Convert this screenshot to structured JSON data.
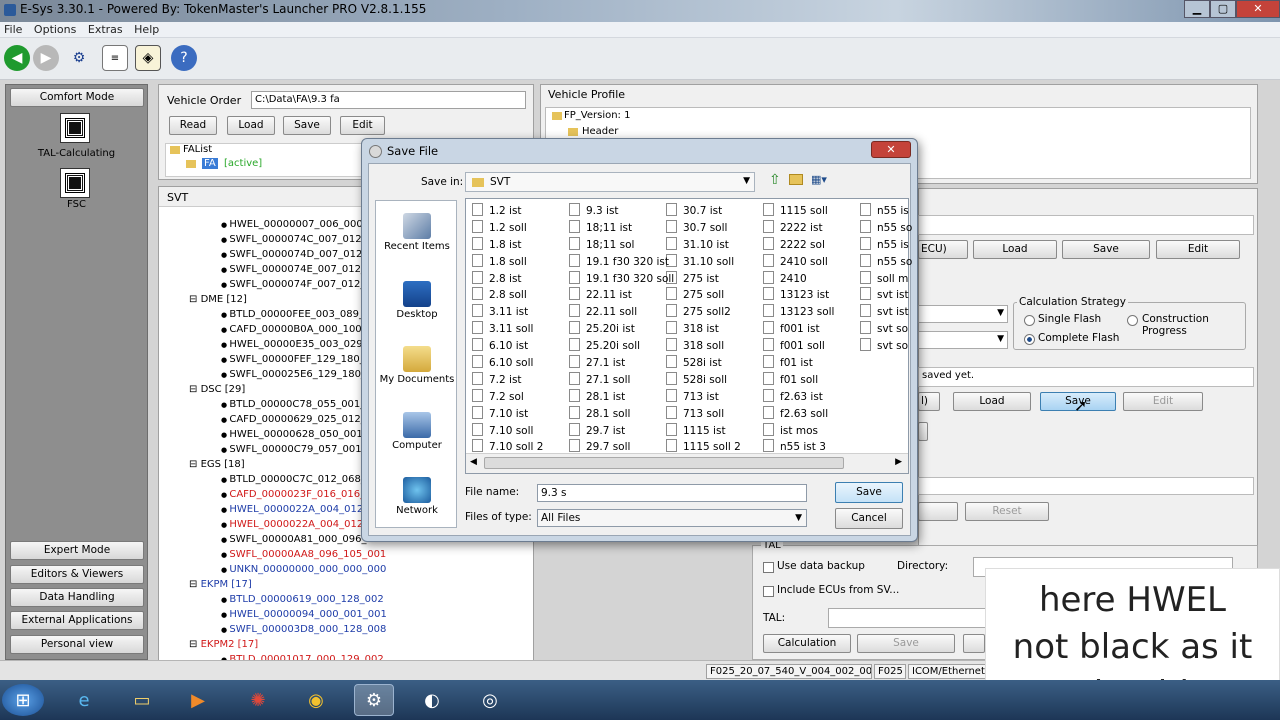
{
  "window": {
    "title": "E-Sys 3.30.1 - Powered By: TokenMaster's Launcher PRO V2.8.1.155"
  },
  "menu": [
    "File",
    "Options",
    "Extras",
    "Help"
  ],
  "left": {
    "comfort": "Comfort Mode",
    "tal_calc": "TAL-Calculating",
    "fsc": "FSC",
    "expert": "Expert Mode",
    "editors": "Editors & Viewers",
    "data": "Data Handling",
    "external": "External Applications",
    "personal": "Personal view"
  },
  "order": {
    "label": "Vehicle Order",
    "path": "C:\\Data\\FA\\9.3 fa",
    "read": "Read",
    "load": "Load",
    "save": "Save",
    "edit": "Edit",
    "falist": "FAList",
    "fa": "FA",
    "active": "[active]"
  },
  "svt": {
    "label": "SVT"
  },
  "tree": [
    {
      "t": "HWEL_00000007_006_000_",
      "c": "k"
    },
    {
      "t": "SWFL_0000074C_007_012_",
      "c": "k"
    },
    {
      "t": "SWFL_0000074D_007_012_",
      "c": "k"
    },
    {
      "t": "SWFL_0000074E_007_012_",
      "c": "k"
    },
    {
      "t": "SWFL_0000074F_007_012_",
      "c": "k"
    },
    {
      "t": "DME [12]",
      "c": "g"
    },
    {
      "t": "BTLD_00000FEE_003_089_",
      "c": "k"
    },
    {
      "t": "CAFD_00000B0A_000_100_",
      "c": "k"
    },
    {
      "t": "HWEL_00000E35_003_029_",
      "c": "k"
    },
    {
      "t": "SWFL_00000FEF_129_180_",
      "c": "k"
    },
    {
      "t": "SWFL_000025E6_129_180_",
      "c": "k"
    },
    {
      "t": "DSC [29]",
      "c": "g"
    },
    {
      "t": "BTLD_00000C78_055_001_",
      "c": "k"
    },
    {
      "t": "CAFD_00000629_025_012_",
      "c": "k"
    },
    {
      "t": "HWEL_00000628_050_001_",
      "c": "k"
    },
    {
      "t": "SWFL_00000C79_057_001_",
      "c": "k"
    },
    {
      "t": "EGS [18]",
      "c": "g"
    },
    {
      "t": "BTLD_00000C7C_012_068_",
      "c": "k"
    },
    {
      "t": "CAFD_0000023F_016_016_",
      "c": "r"
    },
    {
      "t": "HWEL_0000022A_004_012_",
      "c": "b"
    },
    {
      "t": "HWEL_0000022A_004_012_",
      "c": "r"
    },
    {
      "t": "SWFL_00000A81_000_096_",
      "c": "k"
    },
    {
      "t": "SWFL_00000AA8_096_105_001",
      "c": "r"
    },
    {
      "t": "UNKN_00000000_000_000_000",
      "c": "b"
    },
    {
      "t": "EKPM [17]",
      "c": "gb"
    },
    {
      "t": "BTLD_00000619_000_128_002",
      "c": "b"
    },
    {
      "t": "HWEL_00000094_000_001_001",
      "c": "b"
    },
    {
      "t": "SWFL_000003D8_000_128_008",
      "c": "b"
    },
    {
      "t": "EKPM2 [17]",
      "c": "gr"
    },
    {
      "t": "BTLD_00001017_000_129_002",
      "c": "r"
    }
  ],
  "profile": {
    "label": "Vehicle Profile",
    "fp": "FP_Version: 1",
    "header": "Header"
  },
  "right": {
    "ecu_tail": "ECU)",
    "load1": "Load",
    "save1": "Save",
    "edit1": "Edit",
    "calc_strategy": "Calculation Strategy",
    "single": "Single Flash",
    "construction": "Construction Progress",
    "complete": "Complete Flash",
    "saved": "saved yet.",
    "tail2": "l)",
    "load2": "Load",
    "save2": "Save",
    "edit2": "Edit",
    "reset": "Reset",
    "tal_hdr": "TAL",
    "use_backup": "Use data backup",
    "directory": "Directory:",
    "include_ecus": "Include ECUs from SV...",
    "tal_label": "TAL:",
    "calculation": "Calculation",
    "save3": "Save"
  },
  "dialog": {
    "title": "Save File",
    "save_in": "Save in:",
    "folder": "SVT",
    "places": [
      "Recent Items",
      "Desktop",
      "My Documents",
      "Computer",
      "Network"
    ],
    "files": [
      [
        "1.2 ist",
        "1.2 soll",
        "1.8 ist",
        "1.8 soll",
        "2.8 ist",
        "2.8 soll",
        "3.11 ist",
        "3.11 soll",
        "6.10 ist",
        "6.10 soll",
        "7.2 ist",
        "7.2 sol",
        "7.10 ist",
        "7.10 soll",
        "7.10 soll 2"
      ],
      [
        "9.3 ist",
        "18;11 ist",
        "18;11 sol",
        "19.1 f30 320 ist",
        "19.1 f30 320 soll",
        "22.11 ist",
        "22.11 soll",
        "25.20i ist",
        "25.20i soll",
        "27.1 ist",
        "27.1 soll",
        "28.1 ist",
        "28.1 soll",
        "29.7 ist",
        "29.7 soll"
      ],
      [
        "30.7 ist",
        "30.7 soll",
        "31.10 ist",
        "31.10 soll",
        "275 ist",
        "275 soll",
        "275 soll2",
        "318 ist",
        "318 soll",
        "528i ist",
        "528i soll",
        "713 ist",
        "713 soll",
        "1115 ist",
        "1115 soll 2"
      ],
      [
        "1115 soll",
        "2222 ist",
        "2222 sol",
        "2410 soll",
        "2410",
        "13123 ist",
        "13123 soll",
        "f001 ist",
        "f001 soll",
        "f01 ist",
        "f01 soll",
        "f2.63 ist",
        "f2.63 soll",
        "ist mos",
        "n55 ist 3"
      ],
      [
        "n55 is",
        "n55 so",
        "n55 is",
        "n55 so",
        "soll m",
        "svt ist",
        "svt ist",
        "svt so",
        "svt so"
      ]
    ],
    "file_name_label": "File name:",
    "file_name": "9.3 s",
    "file_type_label": "Files of type:",
    "file_type": "All Files",
    "save": "Save",
    "cancel": "Cancel"
  },
  "status": {
    "f1": "F025_20_07_540_V_004_002_000",
    "f2": "F025",
    "f3": "ICOM/Ethernet:"
  },
  "caption": {
    "l1": "here HWEL",
    "l2": "not black as it",
    "l3": "should"
  }
}
